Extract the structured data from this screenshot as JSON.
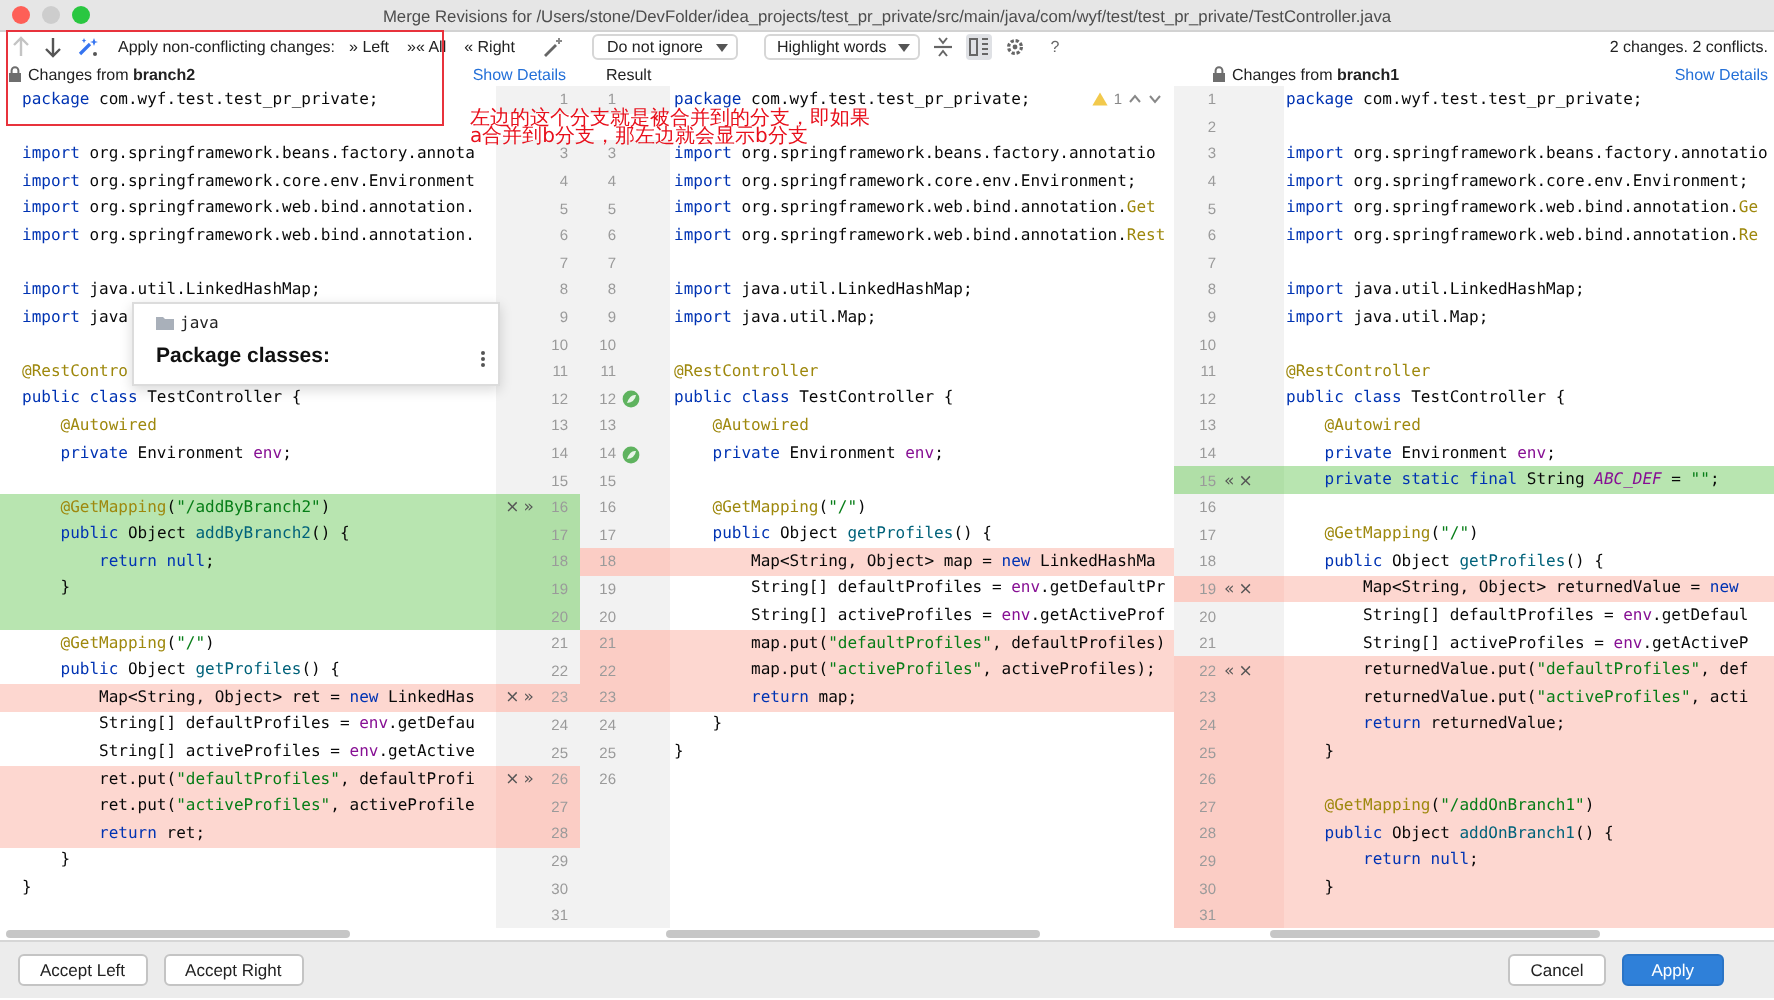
{
  "window": {
    "title": "Merge Revisions for /Users/stone/DevFolder/idea_projects/test_pr_private/src/main/java/com/wyf/test/test_pr_private/TestController.java"
  },
  "toolbar": {
    "items": [
      {
        "kind": "up",
        "disabled": true
      },
      {
        "kind": "down",
        "disabled": false
      },
      {
        "kind": "magic"
      },
      {
        "kind": "label",
        "text": "Apply non-conflicting changes:"
      },
      {
        "kind": "button",
        "text": "» Left"
      },
      {
        "kind": "button",
        "text": "»« All"
      },
      {
        "kind": "button",
        "text": "« Right"
      },
      {
        "kind": "wand"
      },
      {
        "kind": "dropdown",
        "text": "Do not ignore"
      },
      {
        "kind": "dropdown",
        "text": "Highlight words"
      },
      {
        "kind": "collapse",
        "selected": false
      },
      {
        "kind": "columns",
        "selected": true
      },
      {
        "kind": "settings"
      },
      {
        "kind": "help",
        "text": "?"
      }
    ],
    "status": "2 changes. 2 conflicts."
  },
  "panes": {
    "left": {
      "header": "Changes from **branch2**",
      "locked": true,
      "details_link": "Show Details",
      "lines": [
        {
          "number": "1",
          "kind": "plain",
          "tokens": [
            {
              "text": "package",
              "kind": "keyword"
            },
            {
              "text": " com.wyf.test.test_pr_private;"
            }
          ]
        },
        {
          "kind": "plain"
        },
        {
          "number": "3",
          "kind": "plain",
          "tokens": [
            {
              "text": "import",
              "kind": "keyword"
            },
            {
              "text": " org.springframework.beans.factory.annota"
            }
          ]
        },
        {
          "number": "4",
          "kind": "plain",
          "tokens": [
            {
              "text": "import",
              "kind": "keyword"
            },
            {
              "text": " org.springframework.core.env.Environment"
            }
          ]
        },
        {
          "number": "5",
          "kind": "plain",
          "tokens": [
            {
              "text": "import",
              "kind": "keyword"
            },
            {
              "text": " org.springframework.web.bind.annotation."
            }
          ]
        },
        {
          "number": "6",
          "kind": "plain",
          "tokens": [
            {
              "text": "import",
              "kind": "keyword"
            },
            {
              "text": " org.springframework.web.bind.annotation."
            }
          ]
        },
        {
          "number": "7",
          "kind": "plain"
        },
        {
          "number": "8",
          "kind": "plain",
          "tokens": [
            {
              "text": "import",
              "kind": "keyword"
            },
            {
              "text": " java.util.LinkedHashMap;"
            }
          ]
        },
        {
          "number": "9",
          "kind": "plain",
          "tokens": [
            {
              "text": "import",
              "kind": "keyword"
            },
            {
              "text": " java"
            }
          ]
        },
        {
          "number": "10",
          "kind": "plain"
        },
        {
          "number": "11",
          "kind": "plain",
          "tokens": [
            {
              "text": "@RestContro",
              "kind": "annotation"
            }
          ]
        },
        {
          "number": "12",
          "kind": "plain",
          "tokens": [
            {
              "text": "public class",
              "kind": "keyword"
            },
            {
              "text": " TestController {"
            }
          ]
        },
        {
          "number": "13",
          "kind": "plain",
          "tokens": [
            {
              "text": "    @Autowired",
              "kind": "annotation"
            }
          ]
        },
        {
          "number": "14",
          "kind": "plain",
          "tokens": [
            {
              "text": "    private",
              "kind": "keyword"
            },
            {
              "text": " Environment "
            },
            {
              "text": "env",
              "kind": "field"
            },
            {
              "text": ";"
            }
          ]
        },
        {
          "number": "15",
          "kind": "plain"
        },
        {
          "number": "16",
          "kind": "added",
          "actions": [
            "×",
            "»"
          ],
          "tokens": [
            {
              "text": "    @GetMapping",
              "kind": "annotation"
            },
            {
              "text": "("
            },
            {
              "text": "\"/addByBranch2\"",
              "kind": "string"
            },
            {
              "text": ")"
            }
          ]
        },
        {
          "number": "17",
          "kind": "added",
          "tokens": [
            {
              "text": "    public",
              "kind": "keyword"
            },
            {
              "text": " Object "
            },
            {
              "text": "addByBranch2",
              "kind": "method"
            },
            {
              "text": "() {"
            }
          ]
        },
        {
          "number": "18",
          "kind": "added",
          "tokens": [
            {
              "text": "        return null",
              "kind": "keyword"
            },
            {
              "text": ";"
            }
          ]
        },
        {
          "number": "19",
          "kind": "added",
          "tokens": [
            {
              "text": "    }"
            }
          ]
        },
        {
          "number": "20",
          "kind": "added"
        },
        {
          "number": "21",
          "kind": "plain",
          "tokens": [
            {
              "text": "    @GetMapping",
              "kind": "annotation"
            },
            {
              "text": "("
            },
            {
              "text": "\"/\"",
              "kind": "string"
            },
            {
              "text": ")"
            }
          ]
        },
        {
          "number": "22",
          "kind": "plain",
          "tokens": [
            {
              "text": "    public",
              "kind": "keyword"
            },
            {
              "text": " Object "
            },
            {
              "text": "getProfiles",
              "kind": "method"
            },
            {
              "text": "() {"
            }
          ]
        },
        {
          "number": "23",
          "kind": "conflict",
          "actions": [
            "×",
            "»"
          ],
          "tokens": [
            {
              "text": "        Map<String, Object> ret = "
            },
            {
              "text": "new",
              "kind": "keyword"
            },
            {
              "text": " LinkedHas"
            }
          ]
        },
        {
          "number": "24",
          "kind": "plain",
          "tokens": [
            {
              "text": "        String[] defaultProfiles = "
            },
            {
              "text": "env",
              "kind": "field"
            },
            {
              "text": ".getDefau"
            }
          ]
        },
        {
          "number": "25",
          "kind": "plain",
          "tokens": [
            {
              "text": "        String[] activeProfiles = "
            },
            {
              "text": "env",
              "kind": "field"
            },
            {
              "text": ".getActive"
            }
          ]
        },
        {
          "number": "26",
          "kind": "conflict",
          "actions": [
            "×",
            "»"
          ],
          "tokens": [
            {
              "text": "        ret.put("
            },
            {
              "text": "\"defaultProfiles\"",
              "kind": "string"
            },
            {
              "text": ", defaultProfi"
            }
          ]
        },
        {
          "number": "27",
          "kind": "conflict",
          "tokens": [
            {
              "text": "        ret.put("
            },
            {
              "text": "\"activeProfiles\"",
              "kind": "string"
            },
            {
              "text": ", activeProfile"
            }
          ]
        },
        {
          "number": "28",
          "kind": "conflict",
          "tokens": [
            {
              "text": "        return",
              "kind": "keyword"
            },
            {
              "text": " ret;"
            }
          ]
        },
        {
          "number": "29",
          "kind": "plain",
          "tokens": [
            {
              "text": "    }"
            }
          ]
        },
        {
          "number": "30",
          "kind": "plain",
          "tokens": [
            {
              "text": "}"
            }
          ]
        },
        {
          "number": "31",
          "kind": "plain"
        }
      ]
    },
    "result": {
      "header": "Result",
      "lines": [
        {
          "number": "1",
          "kind": "plain",
          "warnings": "1",
          "tokens": [
            {
              "text": "package",
              "kind": "keyword"
            },
            {
              "text": " com.wyf.test.test_pr_private;"
            }
          ]
        },
        {
          "kind": "plain"
        },
        {
          "number": "3",
          "kind": "plain",
          "tokens": [
            {
              "text": "import",
              "kind": "keyword"
            },
            {
              "text": " org.springframework.beans.factory.annotatio"
            }
          ]
        },
        {
          "number": "4",
          "kind": "plain",
          "tokens": [
            {
              "text": "import",
              "kind": "keyword"
            },
            {
              "text": " org.springframework.core.env.Environment;"
            }
          ]
        },
        {
          "number": "5",
          "kind": "plain",
          "tokens": [
            {
              "text": "import",
              "kind": "keyword"
            },
            {
              "text": " org.springframework.web.bind.annotation."
            },
            {
              "text": "Get",
              "kind": "annotation"
            }
          ]
        },
        {
          "number": "6",
          "kind": "plain",
          "tokens": [
            {
              "text": "import",
              "kind": "keyword"
            },
            {
              "text": " org.springframework.web.bind.annotation."
            },
            {
              "text": "Rest",
              "kind": "annotation"
            }
          ]
        },
        {
          "number": "7",
          "kind": "plain"
        },
        {
          "number": "8",
          "kind": "plain",
          "tokens": [
            {
              "text": "import",
              "kind": "keyword"
            },
            {
              "text": " java.util.LinkedHashMap;"
            }
          ]
        },
        {
          "number": "9",
          "kind": "plain",
          "tokens": [
            {
              "text": "import",
              "kind": "keyword"
            },
            {
              "text": " java.util.Map;"
            }
          ]
        },
        {
          "number": "10",
          "kind": "plain"
        },
        {
          "number": "11",
          "kind": "plain",
          "tokens": [
            {
              "text": "@RestController",
              "kind": "annotation"
            }
          ]
        },
        {
          "number": "12",
          "kind": "plain",
          "gutter_icon": true,
          "tokens": [
            {
              "text": "public class",
              "kind": "keyword"
            },
            {
              "text": " TestController {"
            }
          ]
        },
        {
          "number": "13",
          "kind": "plain",
          "tokens": [
            {
              "text": "    @Autowired",
              "kind": "annotation"
            }
          ]
        },
        {
          "number": "14",
          "kind": "plain",
          "gutter_icon": true,
          "tokens": [
            {
              "text": "    private",
              "kind": "keyword"
            },
            {
              "text": " Environment "
            },
            {
              "text": "env",
              "kind": "field"
            },
            {
              "text": ";"
            }
          ]
        },
        {
          "number": "15",
          "kind": "plain"
        },
        {
          "number": "16",
          "kind": "plain",
          "tokens": [
            {
              "text": "    @GetMapping",
              "kind": "annotation"
            },
            {
              "text": "("
            },
            {
              "text": "\"/\"",
              "kind": "string"
            },
            {
              "text": ")"
            }
          ]
        },
        {
          "number": "17",
          "kind": "plain",
          "tokens": [
            {
              "text": "    public",
              "kind": "keyword"
            },
            {
              "text": " Object "
            },
            {
              "text": "getProfiles",
              "kind": "method"
            },
            {
              "text": "() {"
            }
          ]
        },
        {
          "number": "18",
          "kind": "conflict",
          "tokens": [
            {
              "text": "        Map<String, Object> map = "
            },
            {
              "text": "new",
              "kind": "keyword"
            },
            {
              "text": " LinkedHashMa"
            }
          ]
        },
        {
          "number": "19",
          "kind": "plain",
          "tokens": [
            {
              "text": "        String[] defaultProfiles = "
            },
            {
              "text": "env",
              "kind": "field"
            },
            {
              "text": ".getDefaultPr"
            }
          ]
        },
        {
          "number": "20",
          "kind": "plain",
          "tokens": [
            {
              "text": "        String[] activeProfiles = "
            },
            {
              "text": "env",
              "kind": "field"
            },
            {
              "text": ".getActiveProf"
            }
          ]
        },
        {
          "number": "21",
          "kind": "conflict",
          "tokens": [
            {
              "text": "        map.put("
            },
            {
              "text": "\"defaultProfiles\"",
              "kind": "string"
            },
            {
              "text": ", defaultProfiles)"
            }
          ]
        },
        {
          "number": "22",
          "kind": "conflict",
          "tokens": [
            {
              "text": "        map.put("
            },
            {
              "text": "\"activeProfiles\"",
              "kind": "string"
            },
            {
              "text": ", activeProfiles);"
            }
          ]
        },
        {
          "number": "23",
          "kind": "conflict",
          "tokens": [
            {
              "text": "        return",
              "kind": "keyword"
            },
            {
              "text": " map;"
            }
          ]
        },
        {
          "number": "24",
          "kind": "plain",
          "tokens": [
            {
              "text": "    }"
            }
          ]
        },
        {
          "number": "25",
          "kind": "plain",
          "tokens": [
            {
              "text": "}"
            }
          ]
        },
        {
          "number": "26",
          "kind": "plain"
        }
      ]
    },
    "right": {
      "header": "Changes from **branch1**",
      "locked": true,
      "details_link": "Show Details",
      "lines": [
        {
          "number": "1",
          "kind": "plain",
          "tokens": [
            {
              "text": "package",
              "kind": "keyword"
            },
            {
              "text": " com.wyf.test.test_pr_private;"
            }
          ]
        },
        {
          "number": "2",
          "kind": "plain"
        },
        {
          "number": "3",
          "kind": "plain",
          "tokens": [
            {
              "text": "import",
              "kind": "keyword"
            },
            {
              "text": " org.springframework.beans.factory.annotatio"
            }
          ]
        },
        {
          "number": "4",
          "kind": "plain",
          "tokens": [
            {
              "text": "import",
              "kind": "keyword"
            },
            {
              "text": " org.springframework.core.env.Environment;"
            }
          ]
        },
        {
          "number": "5",
          "kind": "plain",
          "tokens": [
            {
              "text": "import",
              "kind": "keyword"
            },
            {
              "text": " org.springframework.web.bind.annotation."
            },
            {
              "text": "Ge",
              "kind": "annotation"
            }
          ]
        },
        {
          "number": "6",
          "kind": "plain",
          "tokens": [
            {
              "text": "import",
              "kind": "keyword"
            },
            {
              "text": " org.springframework.web.bind.annotation."
            },
            {
              "text": "Re",
              "kind": "annotation"
            }
          ]
        },
        {
          "number": "7",
          "kind": "plain"
        },
        {
          "number": "8",
          "kind": "plain",
          "tokens": [
            {
              "text": "import",
              "kind": "keyword"
            },
            {
              "text": " java.util.LinkedHashMap;"
            }
          ]
        },
        {
          "number": "9",
          "kind": "plain",
          "tokens": [
            {
              "text": "import",
              "kind": "keyword"
            },
            {
              "text": " java.util.Map;"
            }
          ]
        },
        {
          "number": "10",
          "kind": "plain"
        },
        {
          "number": "11",
          "kind": "plain",
          "tokens": [
            {
              "text": "@RestController",
              "kind": "annotation"
            }
          ]
        },
        {
          "number": "12",
          "kind": "plain",
          "tokens": [
            {
              "text": "public class",
              "kind": "keyword"
            },
            {
              "text": " TestController {"
            }
          ]
        },
        {
          "number": "13",
          "kind": "plain",
          "tokens": [
            {
              "text": "    @Autowired",
              "kind": "annotation"
            }
          ]
        },
        {
          "number": "14",
          "kind": "plain",
          "tokens": [
            {
              "text": "    private",
              "kind": "keyword"
            },
            {
              "text": " Environment "
            },
            {
              "text": "env",
              "kind": "field"
            },
            {
              "text": ";"
            }
          ]
        },
        {
          "number": "15",
          "kind": "added",
          "actions": [
            "«",
            "×"
          ],
          "tokens": [
            {
              "text": "    private static final",
              "kind": "keyword"
            },
            {
              "text": " String "
            },
            {
              "text": "ABC_DEF",
              "kind": "constant"
            },
            {
              "text": " = "
            },
            {
              "text": "\"\"",
              "kind": "string"
            },
            {
              "text": ";"
            }
          ]
        },
        {
          "number": "16",
          "kind": "plain"
        },
        {
          "number": "17",
          "kind": "plain",
          "tokens": [
            {
              "text": "    @GetMapping",
              "kind": "annotation"
            },
            {
              "text": "("
            },
            {
              "text": "\"/\"",
              "kind": "string"
            },
            {
              "text": ")"
            }
          ]
        },
        {
          "number": "18",
          "kind": "plain",
          "tokens": [
            {
              "text": "    public",
              "kind": "keyword"
            },
            {
              "text": " Object "
            },
            {
              "text": "getProfiles",
              "kind": "method"
            },
            {
              "text": "() {"
            }
          ]
        },
        {
          "number": "19",
          "kind": "conflict",
          "actions": [
            "«",
            "×"
          ],
          "tokens": [
            {
              "text": "        Map<String, Object> returnedValue = "
            },
            {
              "text": "new",
              "kind": "keyword"
            }
          ]
        },
        {
          "number": "20",
          "kind": "plain",
          "tokens": [
            {
              "text": "        String[] defaultProfiles = "
            },
            {
              "text": "env",
              "kind": "field"
            },
            {
              "text": ".getDefaul"
            }
          ]
        },
        {
          "number": "21",
          "kind": "plain",
          "tokens": [
            {
              "text": "        String[] activeProfiles = "
            },
            {
              "text": "env",
              "kind": "field"
            },
            {
              "text": ".getActiveP"
            }
          ]
        },
        {
          "number": "22",
          "kind": "conflict",
          "actions": [
            "«",
            "×"
          ],
          "tokens": [
            {
              "text": "        returnedValue.put("
            },
            {
              "text": "\"defaultProfiles\"",
              "kind": "string"
            },
            {
              "text": ", def"
            }
          ]
        },
        {
          "number": "23",
          "kind": "conflict",
          "tokens": [
            {
              "text": "        returnedValue.put("
            },
            {
              "text": "\"activeProfiles\"",
              "kind": "string"
            },
            {
              "text": ", acti"
            }
          ]
        },
        {
          "number": "24",
          "kind": "conflict",
          "tokens": [
            {
              "text": "        return",
              "kind": "keyword"
            },
            {
              "text": " returnedValue;"
            }
          ]
        },
        {
          "number": "25",
          "kind": "conflict",
          "tokens": [
            {
              "text": "    }"
            }
          ]
        },
        {
          "number": "26",
          "kind": "conflict"
        },
        {
          "number": "27",
          "kind": "conflict",
          "tokens": [
            {
              "text": "    @GetMapping",
              "kind": "annotation"
            },
            {
              "text": "("
            },
            {
              "text": "\"/addOnBranch1\"",
              "kind": "string"
            },
            {
              "text": ")"
            }
          ]
        },
        {
          "number": "28",
          "kind": "conflict",
          "tokens": [
            {
              "text": "    public",
              "kind": "keyword"
            },
            {
              "text": " Object "
            },
            {
              "text": "addOnBranch1",
              "kind": "method"
            },
            {
              "text": "() {"
            }
          ]
        },
        {
          "number": "29",
          "kind": "conflict",
          "tokens": [
            {
              "text": "        return null",
              "kind": "keyword"
            },
            {
              "text": ";"
            }
          ]
        },
        {
          "number": "30",
          "kind": "conflict",
          "tokens": [
            {
              "text": "    }"
            }
          ]
        },
        {
          "number": "31",
          "kind": "conflict"
        }
      ]
    }
  },
  "popup": {
    "path": "java",
    "title": "Package classes:"
  },
  "annotation": {
    "lines": [
      "左边的这个分支就是被合并到的分支，即如果",
      "a合并到b分支，那左边就会显示b分支"
    ]
  },
  "buttons": {
    "left": [
      "Accept Left",
      "Accept Right"
    ],
    "right": [
      {
        "label": "Cancel",
        "primary": false
      },
      {
        "label": "Apply",
        "primary": true
      }
    ]
  }
}
